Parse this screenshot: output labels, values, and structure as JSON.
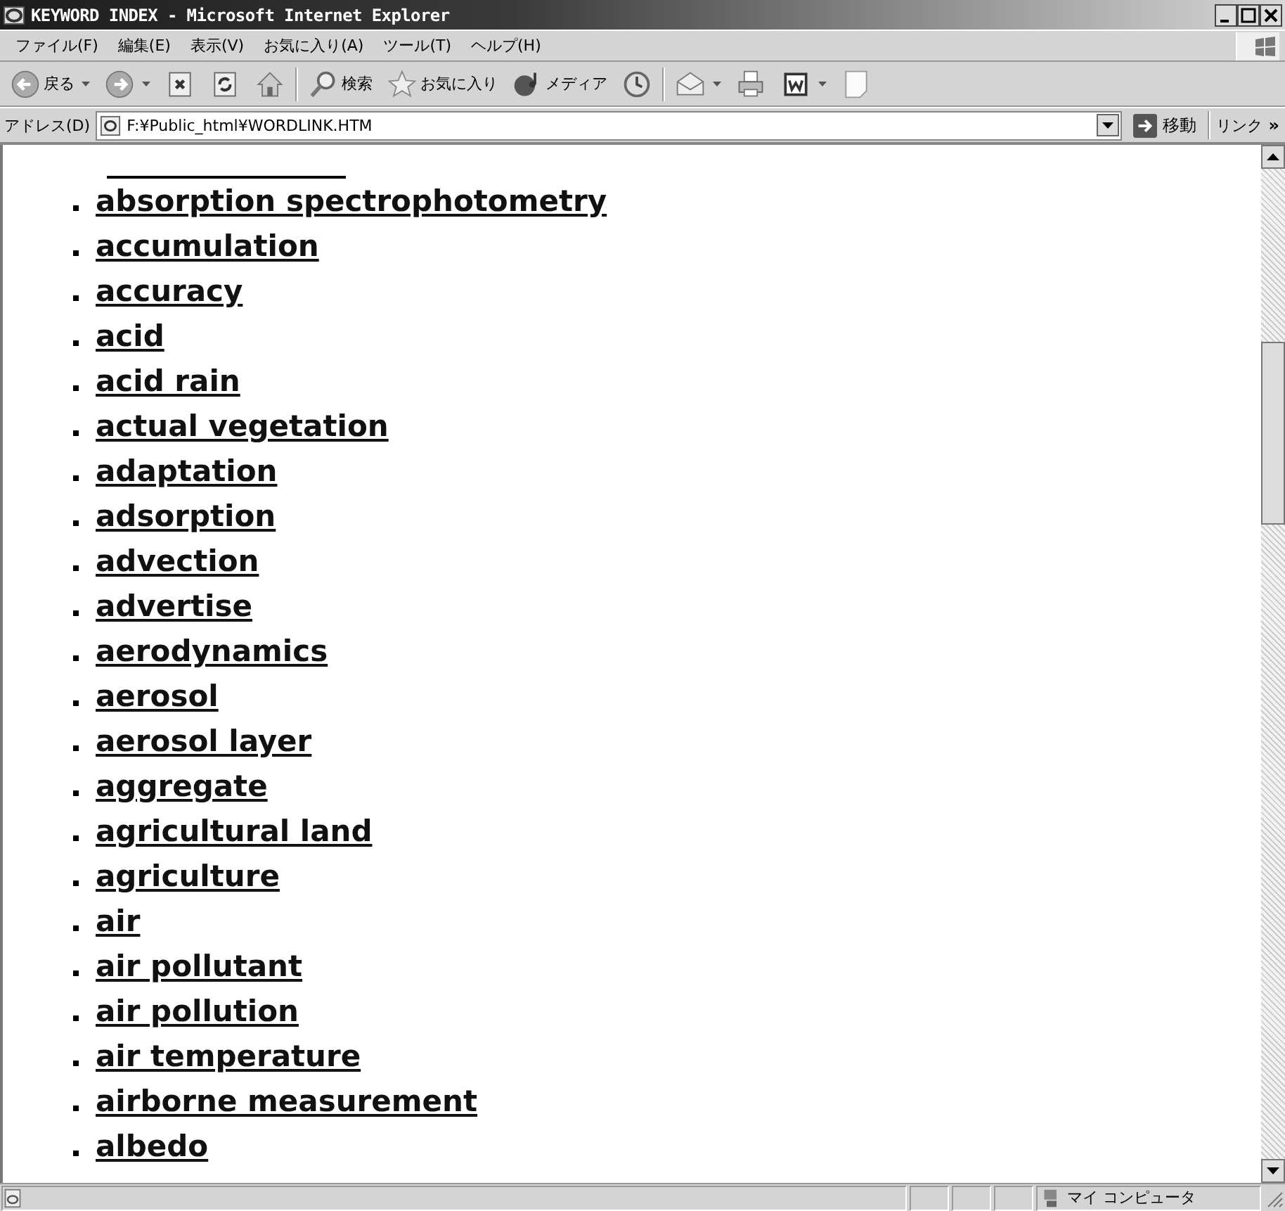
{
  "window": {
    "title": "KEYWORD INDEX - Microsoft Internet Explorer"
  },
  "menu": [
    "ファイル(F)",
    "編集(E)",
    "表示(V)",
    "お気に入り(A)",
    "ツール(T)",
    "ヘルプ(H)"
  ],
  "toolbar": [
    {
      "kind": "back",
      "label": "戻る",
      "dropdown": true
    },
    {
      "kind": "forward",
      "dropdown": true
    },
    {
      "kind": "stop"
    },
    {
      "kind": "refresh"
    },
    {
      "kind": "home"
    },
    {
      "kind": "separator"
    },
    {
      "kind": "search",
      "label": "検索"
    },
    {
      "kind": "favorites",
      "label": "お気に入り"
    },
    {
      "kind": "media",
      "label": "メディア"
    },
    {
      "kind": "history"
    },
    {
      "kind": "separator"
    },
    {
      "kind": "mail",
      "dropdown": true
    },
    {
      "kind": "print"
    },
    {
      "kind": "edit",
      "dropdown": true
    },
    {
      "kind": "blank"
    }
  ],
  "address": {
    "label": "アドレス(D)",
    "value": "F:¥Public_html¥WORDLINK.HTM",
    "go": "移動",
    "links": "リンク",
    "more": "»"
  },
  "items": [
    "absorption spectrophotometry",
    "accumulation",
    "accuracy",
    "acid",
    "acid rain",
    "actual vegetation",
    "adaptation",
    "adsorption",
    "advection",
    "advertise",
    "aerodynamics",
    "aerosol",
    "aerosol layer",
    "aggregate",
    "agricultural land",
    "agriculture",
    "air",
    "air pollutant",
    "air pollution",
    "air temperature",
    "airborne measurement",
    "albedo"
  ],
  "status_bar": {
    "zone": "マイ コンピュータ"
  }
}
